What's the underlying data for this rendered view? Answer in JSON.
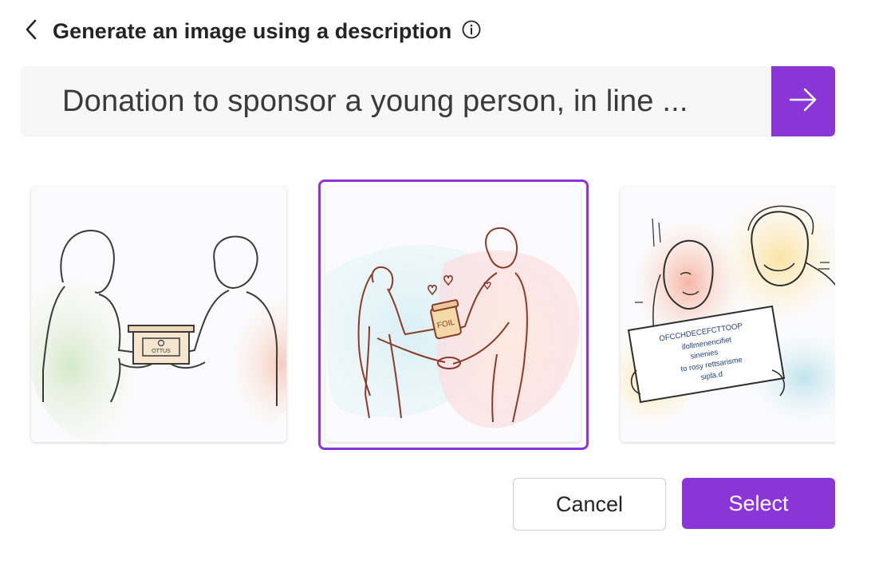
{
  "header": {
    "title": "Generate an image using a description",
    "back_icon": "chevron-left-icon",
    "info_icon": "info-icon"
  },
  "prompt": {
    "value": "Donation to sponsor a young person, in line ...",
    "submit_icon": "arrow-right-icon"
  },
  "gallery": {
    "selected_index": 1,
    "images": [
      {
        "box_label": "OTTUS"
      },
      {
        "jar_label": "FOIL"
      },
      {
        "sign_lines": [
          "OFCCHDECEFCTTOOP",
          "ifollmenencifiet",
          "sinenies",
          "to rosy rettsarisme",
          "sipla.d"
        ]
      }
    ]
  },
  "actions": {
    "cancel_label": "Cancel",
    "select_label": "Select"
  },
  "colors": {
    "accent": "#8b35d6",
    "prompt_bg": "#f7f7f7"
  }
}
